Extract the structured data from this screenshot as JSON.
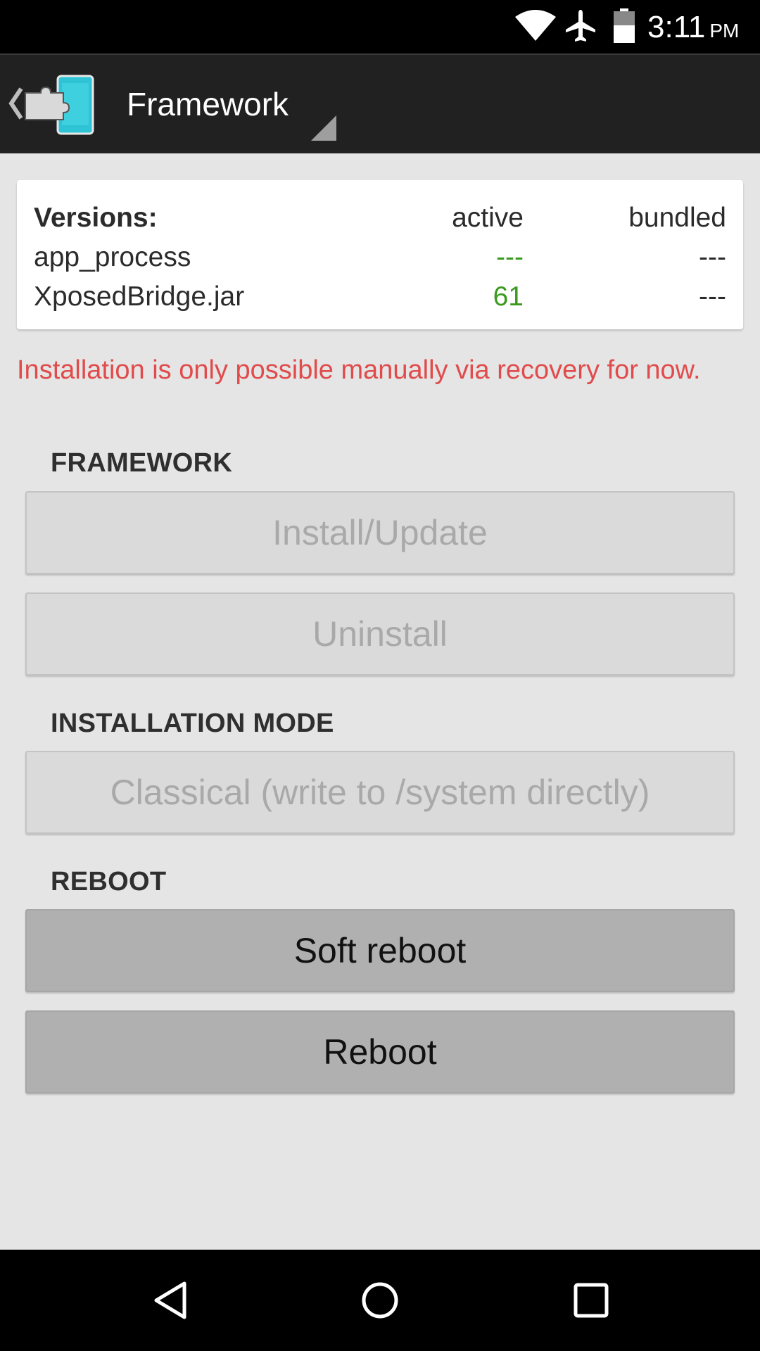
{
  "status_bar": {
    "time": "3:11",
    "ampm": "PM",
    "icons": [
      "wifi-icon",
      "airplane-icon",
      "battery-icon"
    ]
  },
  "action_bar": {
    "title": "Framework",
    "icons": [
      "up-chevron-icon",
      "xposed-app-icon",
      "spinner-triangle-icon"
    ]
  },
  "versions": {
    "header": {
      "label": "Versions:",
      "col_active": "active",
      "col_bundled": "bundled"
    },
    "rows": [
      {
        "name": "app_process",
        "active": "---",
        "bundled": "---"
      },
      {
        "name": "XposedBridge.jar",
        "active": "61",
        "bundled": "---"
      }
    ]
  },
  "warning_text": "Installation is only possible manually via recovery for now.",
  "sections": {
    "framework": {
      "header": "FRAMEWORK",
      "install_label": "Install/Update",
      "uninstall_label": "Uninstall"
    },
    "installation_mode": {
      "header": "INSTALLATION MODE",
      "mode_label": "Classical (write to /system directly)"
    },
    "reboot": {
      "header": "REBOOT",
      "soft_reboot_label": "Soft reboot",
      "reboot_label": "Reboot"
    }
  },
  "nav_bar": {
    "icons": [
      "back-icon",
      "home-icon",
      "recents-icon"
    ]
  },
  "colors": {
    "warning": "#e14b4b",
    "active_green": "#3a9a1e",
    "action_bar": "#212121",
    "background": "#e5e5e5"
  }
}
